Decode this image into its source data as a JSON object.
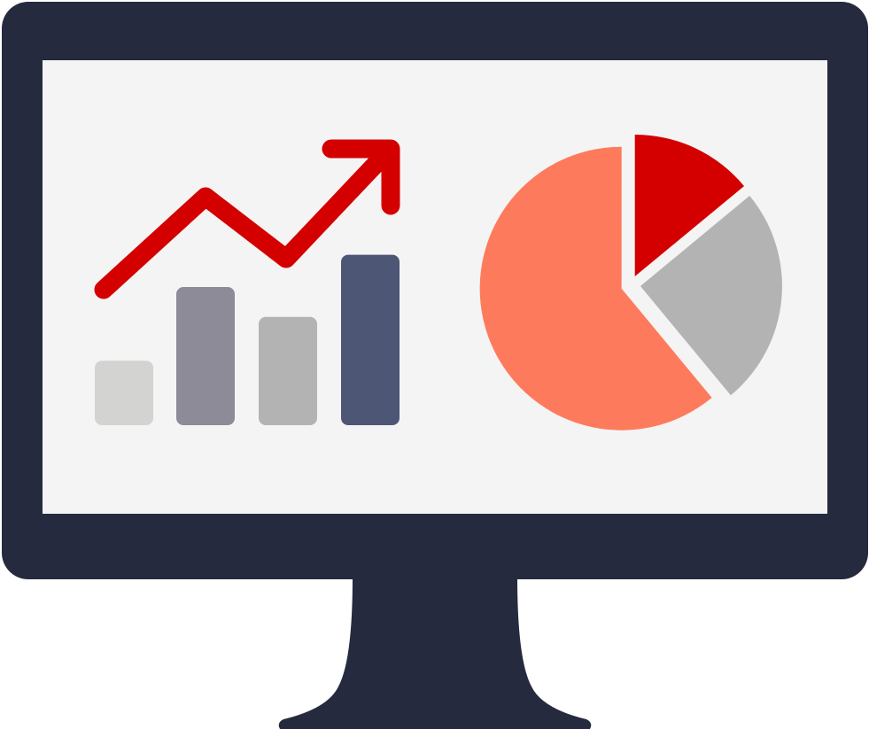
{
  "colors": {
    "monitor": "#262a3e",
    "screen": "#f4f4f4",
    "trend_arrow": "#d40000",
    "bar_1": "#d3d3d1",
    "bar_2": "#8c8b97",
    "bar_3": "#b3b3b3",
    "bar_4": "#4d5675",
    "pie_main": "#fd7b5c",
    "pie_red": "#d40000",
    "pie_grey": "#b3b3b3"
  },
  "icons": {
    "monitor": "monitor-icon",
    "trend": "trend-up-arrow-icon",
    "bars": "bar-chart-icon",
    "pie": "pie-chart-icon"
  },
  "bar_levels": [
    0.28,
    0.6,
    0.47,
    0.74
  ],
  "pie_slices": [
    {
      "color_key": "pie_main",
      "share": 0.61
    },
    {
      "color_key": "pie_red",
      "share": 0.14
    },
    {
      "color_key": "pie_grey",
      "share": 0.25
    }
  ]
}
